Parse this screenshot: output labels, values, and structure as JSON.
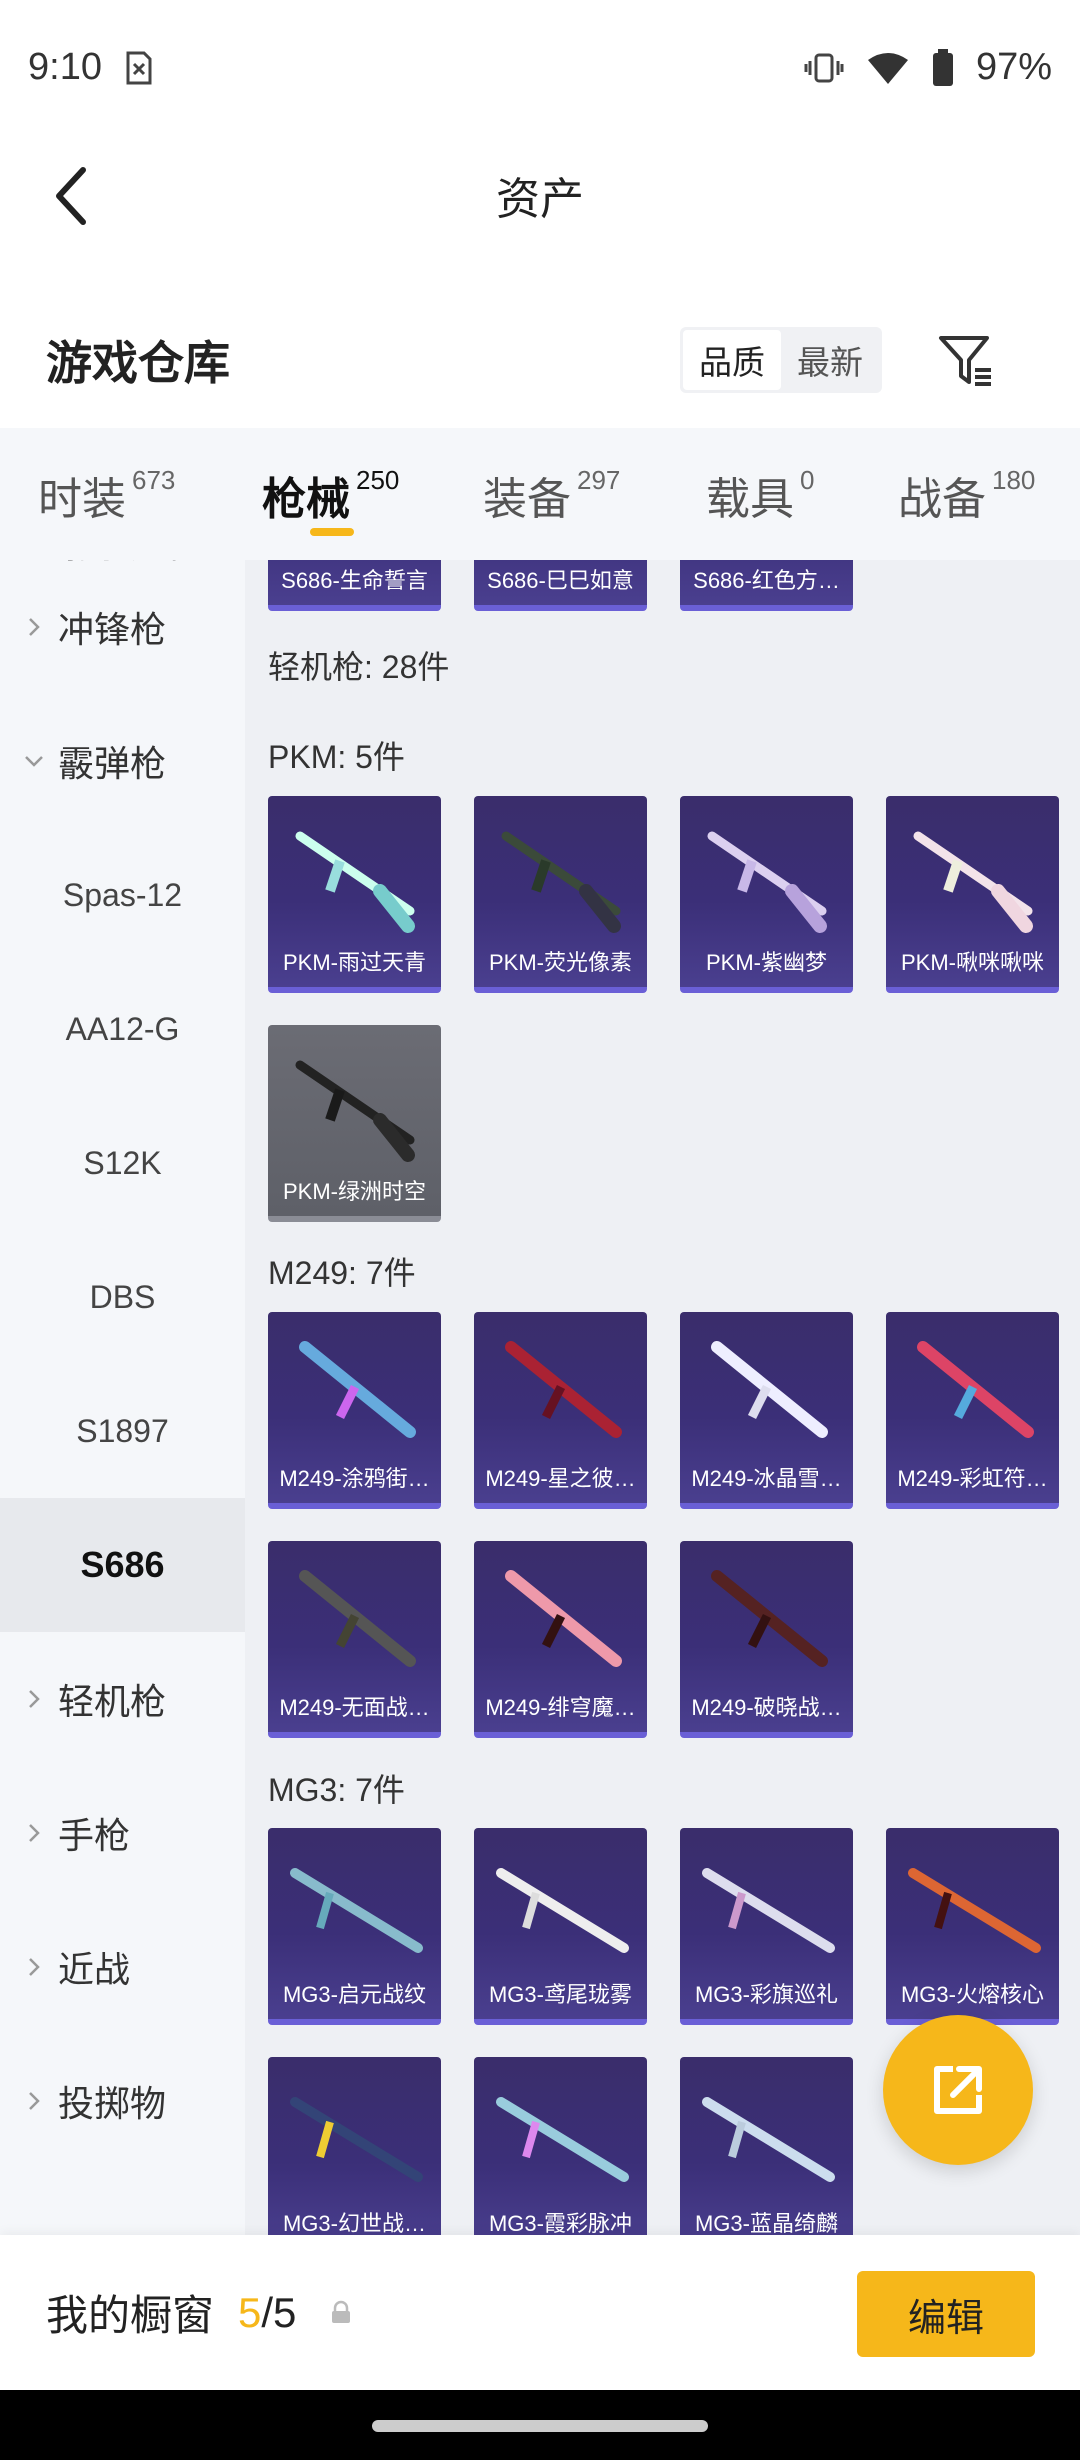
{
  "status_bar": {
    "time": "9:10",
    "battery": "97%"
  },
  "header": {
    "title": "资产"
  },
  "warehouse": {
    "title": "游戏仓库",
    "sort_quality": "品质",
    "sort_newest": "最新"
  },
  "tabs": [
    {
      "label": "时装",
      "count": "673"
    },
    {
      "label": "枪械",
      "count": "250"
    },
    {
      "label": "装备",
      "count": "297"
    },
    {
      "label": "载具",
      "count": "0"
    },
    {
      "label": "战备",
      "count": "180"
    }
  ],
  "sidebar": {
    "items": [
      {
        "label": "射手步枪"
      },
      {
        "label": "冲锋枪"
      },
      {
        "label": "霰弹枪"
      },
      {
        "label": "Spas-12"
      },
      {
        "label": "AA12-G"
      },
      {
        "label": "S12K"
      },
      {
        "label": "DBS"
      },
      {
        "label": "S1897"
      },
      {
        "label": "S686"
      },
      {
        "label": "轻机枪"
      },
      {
        "label": "手枪"
      },
      {
        "label": "近战"
      },
      {
        "label": "投掷物"
      }
    ]
  },
  "content": {
    "top_row": [
      "S686-生命誓言",
      "S686-巳巳如意",
      "S686-红色方…"
    ],
    "lmg_header": "轻机枪: 28件",
    "pkm": {
      "header": "PKM: 5件",
      "items": [
        "PKM-雨过天青",
        "PKM-荧光像素",
        "PKM-紫幽梦",
        "PKM-啾咪啾咪",
        "PKM-绿洲时空"
      ]
    },
    "m249": {
      "header": "M249: 7件",
      "items": [
        "M249-涂鸦街…",
        "M249-星之彼…",
        "M249-冰晶雪…",
        "M249-彩虹符…",
        "M249-无面战…",
        "M249-绯穹魔…",
        "M249-破晓战…"
      ]
    },
    "mg3": {
      "header": "MG3: 7件",
      "items": [
        "MG3-启元战纹",
        "MG3-鸢尾珑雾",
        "MG3-彩旗巡礼",
        "MG3-火熔核心",
        "MG3-幻世战…",
        "MG3-霞彩脉冲",
        "MG3-蓝晶绮麟"
      ]
    }
  },
  "bottom_bar": {
    "title": "我的橱窗",
    "current": "5",
    "total": "/5",
    "edit_label": "编辑"
  },
  "colors": {
    "accent": "#f6b71a",
    "card_purple": "#3b2f78",
    "card_grey": "#6b6c74"
  }
}
